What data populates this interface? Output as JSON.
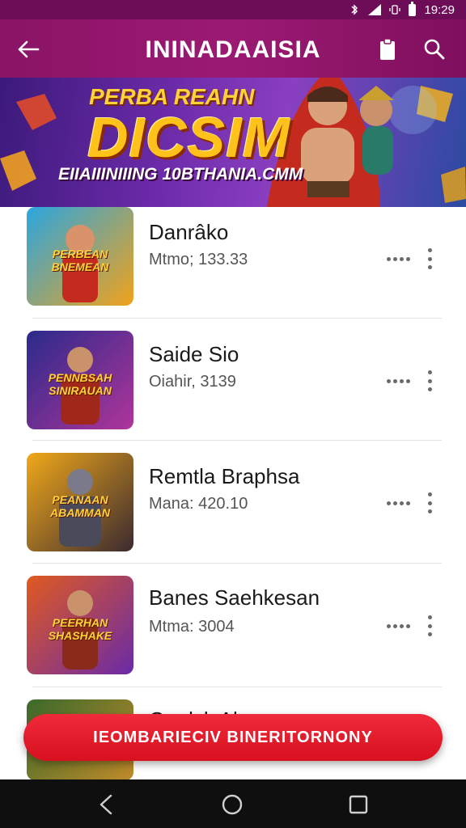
{
  "status_bar": {
    "time": "19:29"
  },
  "app_bar": {
    "title": "ININADAAISIA"
  },
  "banner": {
    "headline": "PERBA REAHN",
    "big_text": "DICSIM",
    "footer": "EIIAIIINIIING 10BTHANIA.CMM"
  },
  "items": [
    {
      "title": "Danrâko",
      "subtitle": "Mtmo; 133.33",
      "thumb_text": "PERBEAN BNEMEAN",
      "thumb_colors": [
        "#2aa6e0",
        "#f2a21a"
      ]
    },
    {
      "title": "Saide Sio",
      "subtitle": "Oiahir, 3139",
      "thumb_text": "PENNBSAH SINIRAUAN",
      "thumb_colors": [
        "#2a2a8a",
        "#b0349a"
      ]
    },
    {
      "title": "Remtla Braphsa",
      "subtitle": "Mana: 420.10",
      "thumb_text": "PEANAAN ABAMMAN",
      "thumb_colors": [
        "#f0a81a",
        "#3a2a30"
      ]
    },
    {
      "title": "Banes Saehkesan",
      "subtitle": "Mtma: 3004",
      "thumb_text": "PEERHAN SHASHAKE",
      "thumb_colors": [
        "#e05a20",
        "#6a2aa8"
      ]
    },
    {
      "title": "Onelsk Al",
      "subtitle": "",
      "thumb_text": "",
      "thumb_colors": [
        "#3a6a2a",
        "#c08a2a"
      ]
    }
  ],
  "cta": {
    "label": "IEOMBARIECIV BINERITORNONY"
  },
  "colors": {
    "app_bar": "#8a1466",
    "status_bar": "#6e0d57",
    "cta": "#e31b2a",
    "nav_bar": "#0f0f0f"
  }
}
